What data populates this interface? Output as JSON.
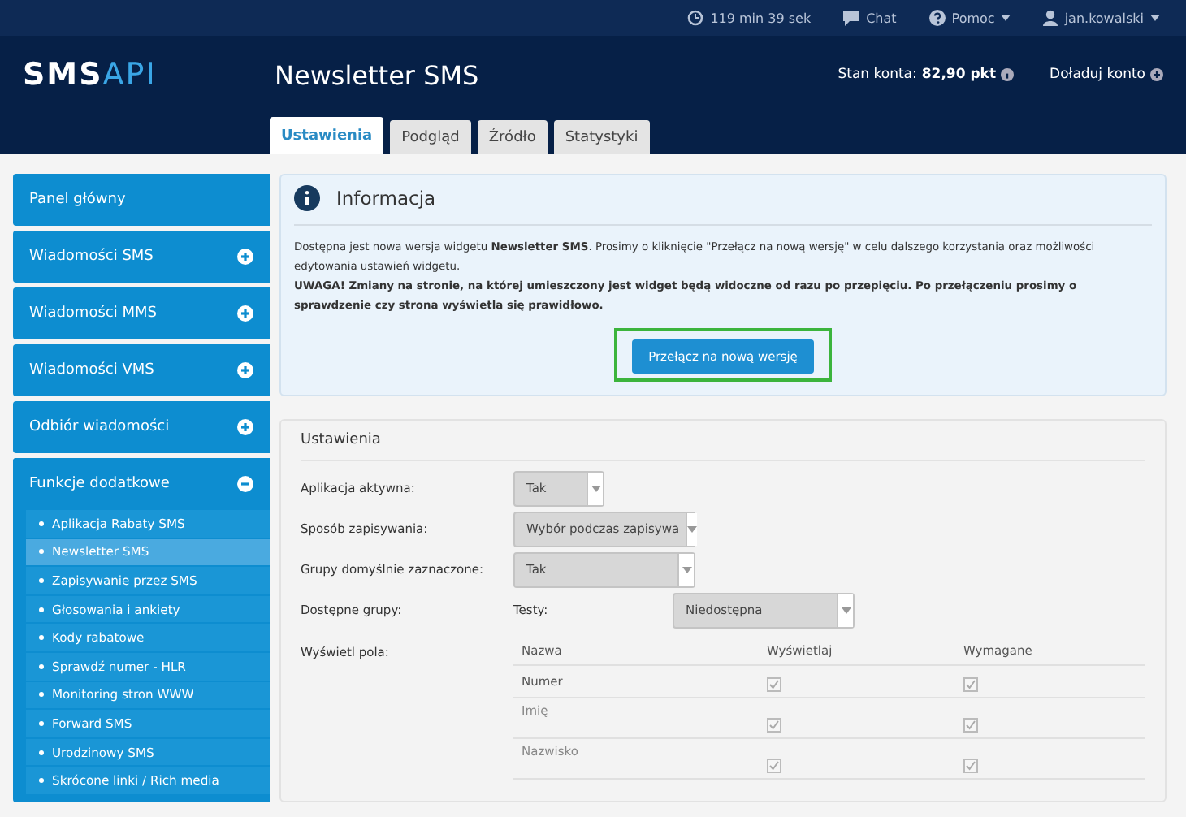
{
  "top_bar": {
    "session_timer": "119 min 39 sek",
    "chat": "Chat",
    "help": "Pomoc",
    "user": "jan.kowalski"
  },
  "header": {
    "logo_left": "SMS",
    "logo_right": "API",
    "title": "Newsletter SMS",
    "balance_label": "Stan konta:",
    "balance_value": "82,90 pkt",
    "top_up": "Doładuj konto"
  },
  "tabs": [
    {
      "label": "Ustawienia",
      "selected": true
    },
    {
      "label": "Podgląd",
      "selected": false
    },
    {
      "label": "Źródło",
      "selected": false
    },
    {
      "label": "Statystyki",
      "selected": false
    }
  ],
  "sidebar": {
    "items": [
      {
        "label": "Panel główny",
        "kind": "link"
      },
      {
        "label": "Wiadomości SMS",
        "kind": "group",
        "expanded": false
      },
      {
        "label": "Wiadomości MMS",
        "kind": "group",
        "expanded": false
      },
      {
        "label": "Wiadomości VMS",
        "kind": "group",
        "expanded": false
      },
      {
        "label": "Odbiór wiadomości",
        "kind": "group",
        "expanded": false
      },
      {
        "label": "Funkcje dodatkowe",
        "kind": "group",
        "expanded": true,
        "children": [
          {
            "label": "Aplikacja Rabaty SMS",
            "selected": false
          },
          {
            "label": "Newsletter SMS",
            "selected": true
          },
          {
            "label": "Zapisywanie przez SMS",
            "selected": false
          },
          {
            "label": "Głosowania i ankiety",
            "selected": false
          },
          {
            "label": "Kody rabatowe",
            "selected": false
          },
          {
            "label": "Sprawdź numer - HLR",
            "selected": false
          },
          {
            "label": "Monitoring stron WWW",
            "selected": false
          },
          {
            "label": "Forward SMS",
            "selected": false
          },
          {
            "label": "Urodzinowy SMS",
            "selected": false
          },
          {
            "label": "Skrócone linki / Rich media",
            "selected": false
          }
        ]
      }
    ]
  },
  "info": {
    "title": "Informacja",
    "paragraphs": [
      "Dostępna jest nowa wersja widgetu **Newsletter SMS**. Prosimy o kliknięcie \"Przełącz na nową wersję\" w celu dalszego korzystania oraz możliwości edytowania ustawień widgetu.",
      "UWAGA! Zmiany na stronie, na której umieszczony jest widget będą widoczne od razu po przepięciu. Po przełączeniu prosimy o sprawdzenie czy strona wyświetla się prawidłowo."
    ],
    "button": "Przełącz na nową wersję"
  },
  "settings": {
    "title": "Ustawienia",
    "fields": [
      {
        "label": "Aplikacja aktywna:",
        "value": "Tak"
      },
      {
        "label": "Sposób zapisywania:",
        "value": "Wybór podczas zapisywa"
      },
      {
        "label": "Grupy domyślnie zaznaczone:",
        "value": "Tak"
      }
    ],
    "groups": {
      "label": "Dostępne grupy:",
      "group": "Testy:",
      "value": "Niedostępna"
    },
    "fields_table": {
      "label": "Wyświetl pola:",
      "columns": [
        "Nazwa",
        "Wyświetlaj",
        "Wymagane"
      ],
      "rows": [
        {
          "name": "Numer",
          "display": true,
          "required": true
        },
        {
          "name": "Imię",
          "display": true,
          "required": true
        },
        {
          "name": "Nazwisko",
          "display": true,
          "required": true
        }
      ]
    }
  }
}
